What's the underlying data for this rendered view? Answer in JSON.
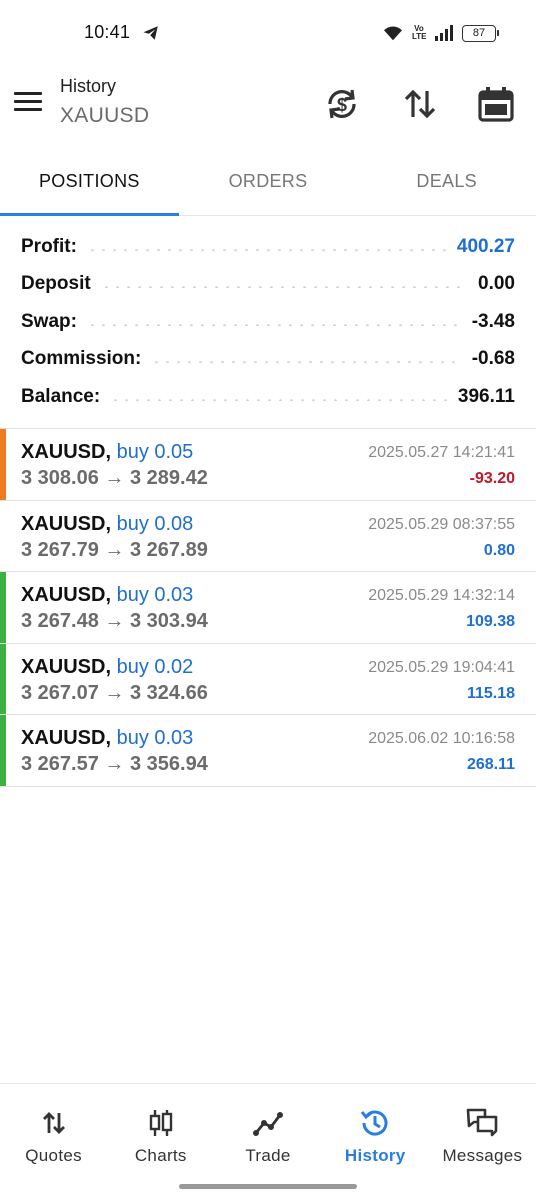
{
  "status_bar": {
    "time": "10:41",
    "volte_top": "Vo",
    "volte_bottom": "LTE",
    "battery": "87"
  },
  "header": {
    "title": "History",
    "symbol": "XAUUSD",
    "icons": [
      "currency-exchange-icon",
      "sort-icon",
      "calendar-icon"
    ]
  },
  "tabs": [
    {
      "label": "POSITIONS",
      "active": true
    },
    {
      "label": "ORDERS",
      "active": false
    },
    {
      "label": "DEALS",
      "active": false
    }
  ],
  "summary": {
    "profit": {
      "label": "Profit:",
      "value": "400.27"
    },
    "deposit": {
      "label": "Deposit",
      "value": "0.00"
    },
    "swap": {
      "label": "Swap:",
      "value": "-3.48"
    },
    "commission": {
      "label": "Commission:",
      "value": "-0.68"
    },
    "balance": {
      "label": "Balance:",
      "value": "396.11"
    }
  },
  "positions": [
    {
      "symbol": "XAUUSD,",
      "side": "buy 0.05",
      "open_price": "3 308.06",
      "arrow": "→",
      "close_price": "3 289.42",
      "time": "2025.05.27 14:21:41",
      "profit": "-93.20",
      "stripe_color": "#f07a22",
      "profit_color": "#c0182a"
    },
    {
      "symbol": "XAUUSD,",
      "side": "buy 0.08",
      "open_price": "3 267.79",
      "arrow": "→",
      "close_price": "3 267.89",
      "time": "2025.05.29 08:37:55",
      "profit": "0.80",
      "stripe_color": "",
      "profit_color": "#1f6fd0"
    },
    {
      "symbol": "XAUUSD,",
      "side": "buy 0.03",
      "open_price": "3 267.48",
      "arrow": "→",
      "close_price": "3 303.94",
      "time": "2025.05.29 14:32:14",
      "profit": "109.38",
      "stripe_color": "#3cb043",
      "profit_color": "#1f6fd0"
    },
    {
      "symbol": "XAUUSD,",
      "side": "buy 0.02",
      "open_price": "3 267.07",
      "arrow": "→",
      "close_price": "3 324.66",
      "time": "2025.05.29 19:04:41",
      "profit": "115.18",
      "stripe_color": "#3cb043",
      "profit_color": "#1f6fd0"
    },
    {
      "symbol": "XAUUSD,",
      "side": "buy 0.03",
      "open_price": "3 267.57",
      "arrow": "→",
      "close_price": "3 356.94",
      "time": "2025.06.02 10:16:58",
      "profit": "268.11",
      "stripe_color": "#3cb043",
      "profit_color": "#1f6fd0"
    }
  ],
  "bottom_nav": [
    {
      "label": "Quotes",
      "icon": "quotes-arrows-icon",
      "active": false
    },
    {
      "label": "Charts",
      "icon": "candlestick-icon",
      "active": false
    },
    {
      "label": "Trade",
      "icon": "trade-line-icon",
      "active": false
    },
    {
      "label": "History",
      "icon": "history-clock-icon",
      "active": true
    },
    {
      "label": "Messages",
      "icon": "messages-icon",
      "active": false
    }
  ],
  "colors": {
    "accent": "#2a7de1",
    "profit_blue": "#1f6fd0",
    "loss_red": "#c0182a",
    "stripe_orange": "#f07a22",
    "stripe_green": "#3cb043"
  }
}
